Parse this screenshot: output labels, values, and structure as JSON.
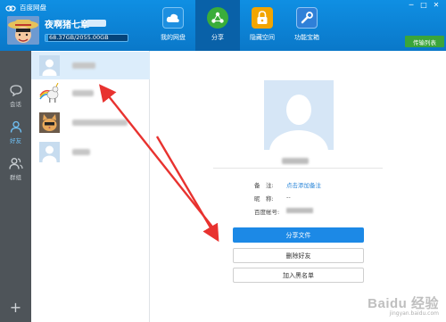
{
  "app": {
    "title": "百度网盘"
  },
  "window_controls": [
    "─",
    "□",
    "✕"
  ],
  "user": {
    "name": "夜啊猪七章",
    "storage_text": "68.37GB/2055.00GB",
    "storage_used_fraction": 0.033
  },
  "nav": [
    {
      "label": "我的网盘",
      "icon": "cloud-drive-icon",
      "active": false,
      "color": "#1d8fe0"
    },
    {
      "label": "分享",
      "icon": "share-icon",
      "active": true,
      "color": "#3aad3a"
    },
    {
      "label": "隐藏空间",
      "icon": "lock-icon",
      "active": false,
      "color": "#f2a500"
    },
    {
      "label": "功能宝箱",
      "icon": "toolbox-icon",
      "active": false,
      "color": "#2f80d8"
    }
  ],
  "transfer_button": {
    "label": "传输列表"
  },
  "rail": {
    "items": [
      {
        "label": "会话",
        "icon": "chat-icon",
        "active": false
      },
      {
        "label": "好友",
        "icon": "friend-icon",
        "active": true
      },
      {
        "label": "群组",
        "icon": "group-icon",
        "active": false
      }
    ],
    "add_label": "+"
  },
  "friends": [
    {
      "avatar": "default-avatar",
      "selected": true
    },
    {
      "avatar": "unicorn-avatar",
      "selected": false
    },
    {
      "avatar": "cat-avatar",
      "selected": false
    },
    {
      "avatar": "default-avatar",
      "selected": false
    }
  ],
  "detail": {
    "remark_label": "备　注:",
    "remark_value": "点击添加备注",
    "nickname_label": "昵　称:",
    "nickname_value": "--",
    "account_label": "百度帐号:",
    "share_button": "分享文件",
    "delete_button": "删除好友",
    "blacklist_button": "加入黑名单"
  },
  "watermark": {
    "main": "Baidu 经验",
    "sub": "jingyan.baidu.com"
  },
  "colors": {
    "header": "#0f8fe3",
    "nav_active": "#0961a8",
    "rail": "#4e5459",
    "selected_row": "#dcedfb",
    "primary_button": "#1c89e6",
    "arrow": "#e8322f"
  }
}
